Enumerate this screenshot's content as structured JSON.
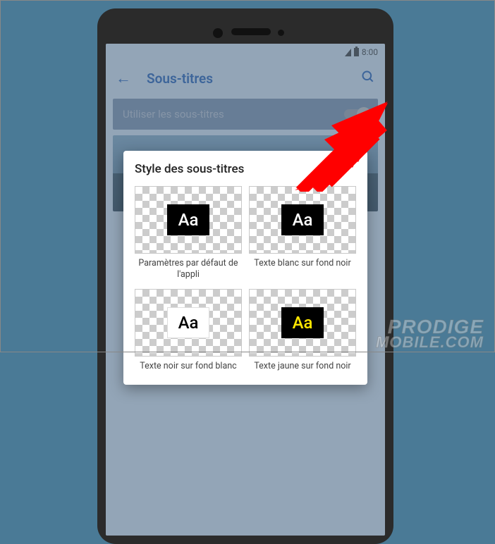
{
  "statusbar": {
    "time": "8:00"
  },
  "appbar": {
    "title": "Sous-titres"
  },
  "toggle_row": {
    "label": "Utiliser les sous-titres"
  },
  "dialog": {
    "title": "Style des sous-titres",
    "options": [
      {
        "sample": "Aa",
        "label": "Paramètres par défaut de l'appli"
      },
      {
        "sample": "Aa",
        "label": "Texte blanc sur fond noir"
      },
      {
        "sample": "Aa",
        "label": "Texte noir sur fond blanc"
      },
      {
        "sample": "Aa",
        "label": "Texte jaune sur fond noir"
      }
    ]
  },
  "watermark": {
    "line1": "PRODIGE",
    "line2": "MOBILE.COM"
  }
}
